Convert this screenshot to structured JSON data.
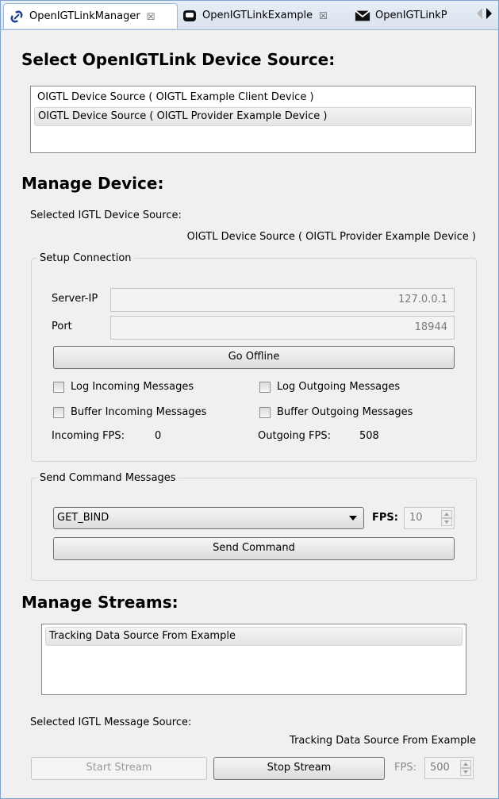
{
  "tabs": [
    {
      "label": "OpenIGTLinkManager",
      "icon": "link-icon",
      "active": true
    },
    {
      "label": "OpenIGTLinkExample",
      "icon": "tray-icon",
      "active": false
    },
    {
      "label": "OpenIGTLinkP",
      "icon": "envelope-icon",
      "active": false
    }
  ],
  "tab_close": "☒",
  "device_source": {
    "title": "Select OpenIGTLink Device Source:",
    "items": [
      "OIGTL Device Source ( OIGTL Example Client Device )",
      "OIGTL Device Source ( OIGTL Provider Example Device )"
    ],
    "selected_index": 1
  },
  "manage_device": {
    "title": "Manage Device:",
    "selected_label": "Selected IGTL Device Source:",
    "selected_value": "OIGTL Device Source ( OIGTL Provider Example Device )",
    "setup": {
      "title": "Setup Connection",
      "server_ip_label": "Server-IP",
      "server_ip_value": "127.0.0.1",
      "port_label": "Port",
      "port_value": "18944",
      "go_offline": "Go Offline",
      "log_incoming": "Log Incoming Messages",
      "log_outgoing": "Log Outgoing Messages",
      "buffer_incoming": "Buffer Incoming Messages",
      "buffer_outgoing": "Buffer Outgoing Messages",
      "incoming_fps_label": "Incoming FPS:",
      "incoming_fps_value": "0",
      "outgoing_fps_label": "Outgoing FPS:",
      "outgoing_fps_value": "508"
    },
    "command": {
      "title": "Send Command Messages",
      "selected": "GET_BIND",
      "fps_label": "FPS:",
      "fps_value": "10",
      "send": "Send Command"
    }
  },
  "manage_streams": {
    "title": "Manage Streams:",
    "items": [
      "Tracking Data Source From Example"
    ],
    "selected_label": "Selected IGTL Message Source:",
    "selected_value": "Tracking Data Source From Example",
    "start": "Start Stream",
    "stop": "Stop Stream",
    "fps_label": "FPS:",
    "fps_value": "500"
  },
  "colors": {
    "frame_border": "#7da2ce",
    "panel_bg": "#f0f0f0"
  }
}
